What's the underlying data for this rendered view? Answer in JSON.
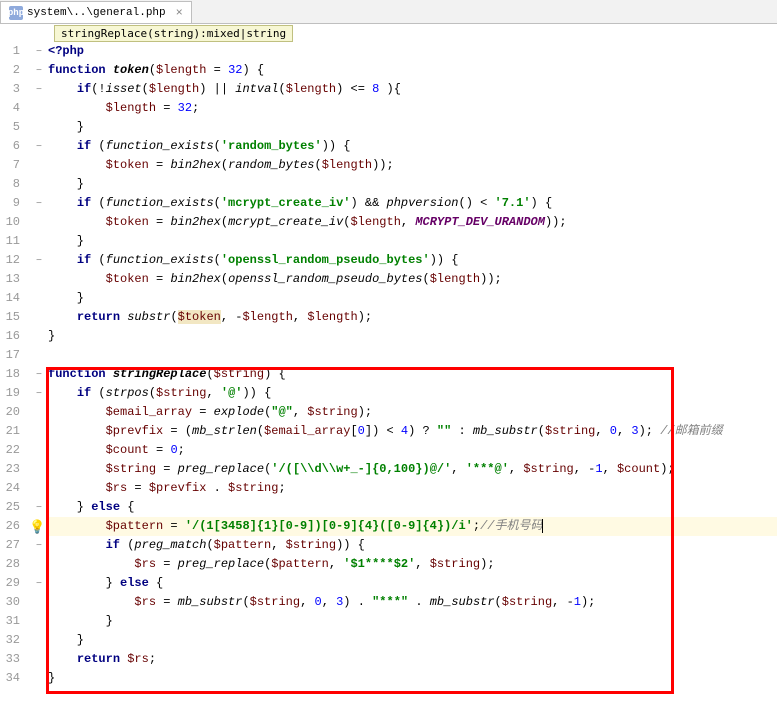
{
  "tab": {
    "icon": "php",
    "label": "system\\..\\general.php",
    "close": "×"
  },
  "tooltip": "stringReplace(string):mixed|string",
  "lines": [
    {
      "n": "1",
      "fold": "−",
      "code": "<span class='kw'>&lt;?php</span>"
    },
    {
      "n": "2",
      "fold": "−",
      "code": "<span class='kw'>function</span> <span class='fn'>token</span>(<span class='var'>$length</span> = <span class='num'>32</span>) {"
    },
    {
      "n": "3",
      "fold": "−",
      "code": "    <span class='kw'>if</span>(!<span class='fni'>isset</span>(<span class='var'>$length</span>) || <span class='fni'>intval</span>(<span class='var'>$length</span>) &lt;= <span class='num'>8</span> ){"
    },
    {
      "n": "4",
      "fold": "",
      "code": "        <span class='var'>$length</span> = <span class='num'>32</span>;"
    },
    {
      "n": "5",
      "fold": "",
      "code": "    }"
    },
    {
      "n": "6",
      "fold": "−",
      "code": "    <span class='kw'>if</span> (<span class='fni'>function_exists</span>(<span class='str'>'random_bytes'</span>)) {"
    },
    {
      "n": "7",
      "fold": "",
      "code": "        <span class='var'>$token</span> = <span class='fni'>bin2hex</span>(<span class='fni'>random_bytes</span>(<span class='var'>$length</span>));"
    },
    {
      "n": "8",
      "fold": "",
      "code": "    }"
    },
    {
      "n": "9",
      "fold": "−",
      "code": "    <span class='kw'>if</span> (<span class='fni'>function_exists</span>(<span class='str'>'mcrypt_create_iv'</span>) &amp;&amp; <span class='fni'>phpversion</span>() &lt; <span class='str'>'7.1'</span>) {"
    },
    {
      "n": "10",
      "fold": "",
      "code": "        <span class='var'>$token</span> = <span class='fni'>bin2hex</span>(<span class='fni'>mcrypt_create_iv</span>(<span class='var'>$length</span>, <span class='const'>MCRYPT_DEV_URANDOM</span>));"
    },
    {
      "n": "11",
      "fold": "",
      "code": "    }"
    },
    {
      "n": "12",
      "fold": "−",
      "code": "    <span class='kw'>if</span> (<span class='fni'>function_exists</span>(<span class='str'>'openssl_random_pseudo_bytes'</span>)) {"
    },
    {
      "n": "13",
      "fold": "",
      "code": "        <span class='var'>$token</span> = <span class='fni'>bin2hex</span>(<span class='fni'>openssl_random_pseudo_bytes</span>(<span class='var'>$length</span>));"
    },
    {
      "n": "14",
      "fold": "",
      "code": "    }"
    },
    {
      "n": "15",
      "fold": "",
      "code": "    <span class='kw'>return</span> <span class='fni'>substr</span>(<span class='warn'><span class='var'>$token</span></span>, -<span class='var'>$length</span>, <span class='var'>$length</span>);"
    },
    {
      "n": "16",
      "fold": "",
      "code": "}"
    },
    {
      "n": "17",
      "fold": "",
      "code": ""
    },
    {
      "n": "18",
      "fold": "−",
      "code": "<span class='kw'>function</span> <span class='fn'>stringReplace</span>(<span class='var'>$string</span>) {"
    },
    {
      "n": "19",
      "fold": "−",
      "code": "    <span class='kw'>if</span> (<span class='fni'>strpos</span>(<span class='var'>$string</span>, <span class='str'>'@'</span>)) {"
    },
    {
      "n": "20",
      "fold": "",
      "code": "        <span class='var'>$email_array</span> = <span class='fni'>explode</span>(<span class='str'>\"@\"</span>, <span class='var'>$string</span>);"
    },
    {
      "n": "21",
      "fold": "",
      "code": "        <span class='var'>$prevfix</span> = (<span class='fni'>mb_strlen</span>(<span class='var'>$email_array</span>[<span class='num'>0</span>]) &lt; <span class='num'>4</span>) ? <span class='str'>\"\"</span> : <span class='fni'>mb_substr</span>(<span class='var'>$string</span>, <span class='num'>0</span>, <span class='num'>3</span>); <span class='cmt'>//邮箱前缀</span>"
    },
    {
      "n": "22",
      "fold": "",
      "code": "        <span class='var'>$count</span> = <span class='num'>0</span>;"
    },
    {
      "n": "23",
      "fold": "",
      "code": "        <span class='var'>$string</span> = <span class='fni'>preg_replace</span>(<span class='str'>'/([\\\\d\\\\w+_-]{0,100})@/'</span>, <span class='str'>'***@'</span>, <span class='var'>$string</span>, -<span class='num'>1</span>, <span class='var'>$count</span>);"
    },
    {
      "n": "24",
      "fold": "",
      "code": "        <span class='var'>$rs</span> = <span class='var'>$prevfix</span> . <span class='var'>$string</span>;"
    },
    {
      "n": "25",
      "fold": "−",
      "code": "    } <span class='kw'>else</span> {"
    },
    {
      "n": "26",
      "fold": "",
      "current": true,
      "bulb": true,
      "code": "        <span class='var'>$pattern</span> = <span class='str'>'/(1[3458]{1}[0-9])[0-9]{4}([0-9]{4})/i'</span>;<span class='cmt'>//手机号码</span><span class='caret'></span>"
    },
    {
      "n": "27",
      "fold": "−",
      "code": "        <span class='kw'>if</span> (<span class='fni'>preg_match</span>(<span class='var'>$pattern</span>, <span class='var'>$string</span>)) {"
    },
    {
      "n": "28",
      "fold": "",
      "code": "            <span class='var'>$rs</span> = <span class='fni'>preg_replace</span>(<span class='var'>$pattern</span>, <span class='str'>'$1****$2'</span>, <span class='var'>$string</span>);"
    },
    {
      "n": "29",
      "fold": "−",
      "code": "        } <span class='kw'>else</span> {"
    },
    {
      "n": "30",
      "fold": "",
      "code": "            <span class='var'>$rs</span> = <span class='fni'>mb_substr</span>(<span class='var'>$string</span>, <span class='num'>0</span>, <span class='num'>3</span>) . <span class='str'>\"***\"</span> . <span class='fni'>mb_substr</span>(<span class='var'>$string</span>, -<span class='num'>1</span>);"
    },
    {
      "n": "31",
      "fold": "",
      "code": "        }"
    },
    {
      "n": "32",
      "fold": "",
      "code": "    }"
    },
    {
      "n": "33",
      "fold": "",
      "code": "    <span class='kw'>return</span> <span class='var'>$rs</span>;"
    },
    {
      "n": "34",
      "fold": "",
      "code": "}"
    }
  ]
}
